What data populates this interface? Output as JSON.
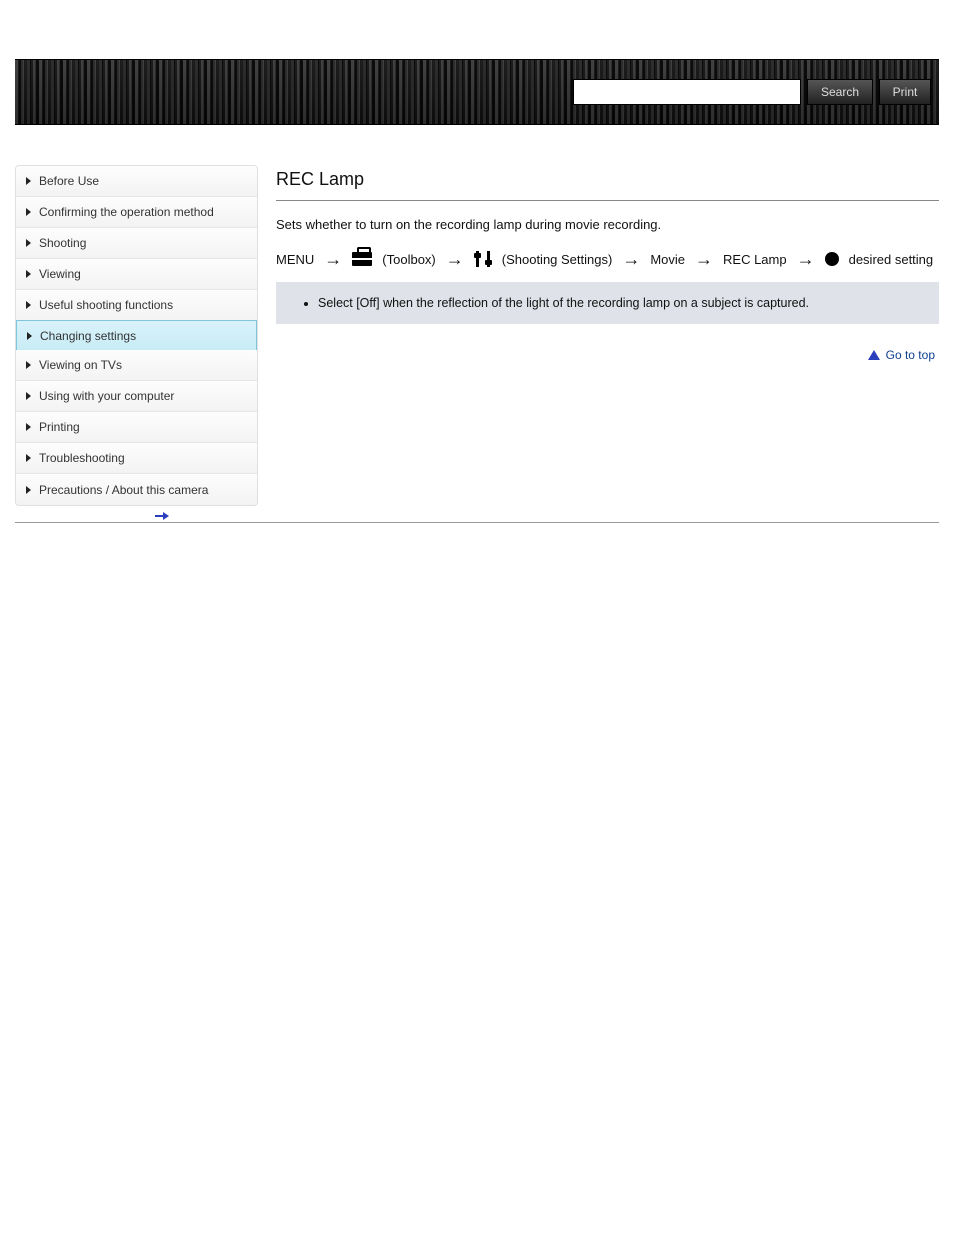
{
  "header": {
    "search_placeholder": "",
    "search_value": "",
    "search_button": "Search",
    "print_button": "Print"
  },
  "sidebar": {
    "items": [
      {
        "label": "Before Use",
        "active": false
      },
      {
        "label": "Confirming the operation method",
        "active": false
      },
      {
        "label": "Shooting",
        "active": false
      },
      {
        "label": "Viewing",
        "active": false
      },
      {
        "label": "Useful shooting functions",
        "active": false
      },
      {
        "label": "Changing settings",
        "active": true
      },
      {
        "label": "Viewing on TVs",
        "active": false
      },
      {
        "label": "Using with your computer",
        "active": false
      },
      {
        "label": "Printing",
        "active": false
      },
      {
        "label": "Troubleshooting",
        "active": false
      },
      {
        "label": "Precautions / About this camera",
        "active": false
      }
    ]
  },
  "content": {
    "title": "REC Lamp",
    "description": "Sets whether to turn on the recording lamp during movie recording.",
    "path": {
      "lead": "MENU",
      "steps": [
        "(Toolbox)",
        "(Shooting Settings)",
        "Movie",
        "REC Lamp",
        "desired setting"
      ]
    },
    "note": "Select [Off] when the reflection of the light of the recording lamp on a subject is captured.",
    "go_to_top": "Go to top"
  },
  "page_nav": {
    "next_label": ""
  }
}
